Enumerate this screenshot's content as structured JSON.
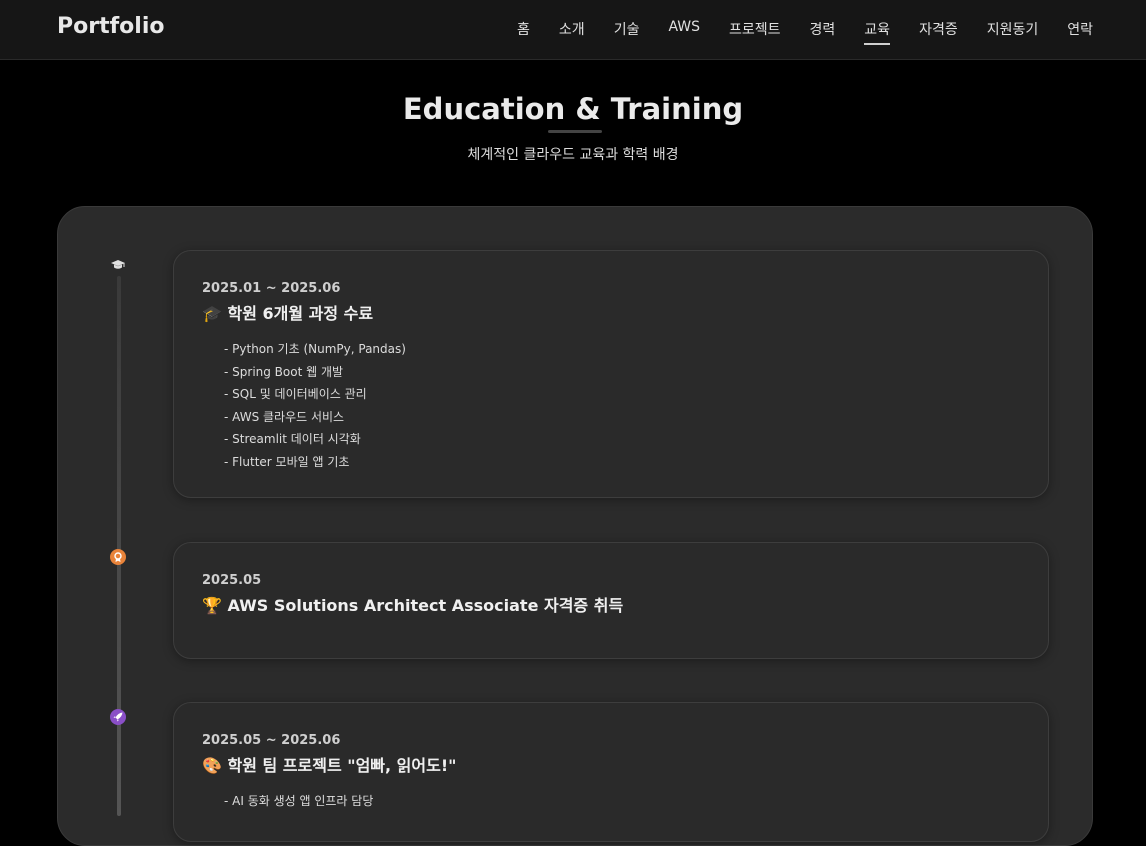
{
  "nav": {
    "brand": "Portfolio",
    "items": [
      "홈",
      "소개",
      "기술",
      "AWS",
      "프로젝트",
      "경력",
      "교육",
      "자격증",
      "지원동기",
      "연락"
    ],
    "active_index": 6
  },
  "section": {
    "title": "Education & Training",
    "subtitle": "체계적인 클라우드 교육과 학력 배경"
  },
  "timeline": [
    {
      "icon": "graduation-cap-icon",
      "date": "2025.01 ~ 2025.06",
      "title": "🎓 학원 6개월 과정 수료",
      "details": [
        "- Python 기초 (NumPy, Pandas)",
        "- Spring Boot 웹 개발",
        "- SQL 및 데이터베이스 관리",
        "- AWS 클라우드 서비스",
        "- Streamlit 데이터 시각화",
        "- Flutter 모바일 앱 기초"
      ]
    },
    {
      "icon": "award-medal-icon",
      "date": "2025.05",
      "title": "🏆 AWS Solutions Architect Associate 자격증 취득",
      "details": []
    },
    {
      "icon": "rocket-icon",
      "date": "2025.05 ~ 2025.06",
      "title": "🎨 학원 팀 프로젝트 \"엄빠, 읽어도!\"",
      "details": [
        "- AI 동화 생성 앱 인프라 담당"
      ]
    }
  ],
  "colors": {
    "background": "#000000",
    "nav_bg": "#161616",
    "panel_bg": "#2b2b2b",
    "icon_grad": "#e0e0e0",
    "icon_award": "#e8833a",
    "icon_rocket": "#8a4fc7"
  }
}
